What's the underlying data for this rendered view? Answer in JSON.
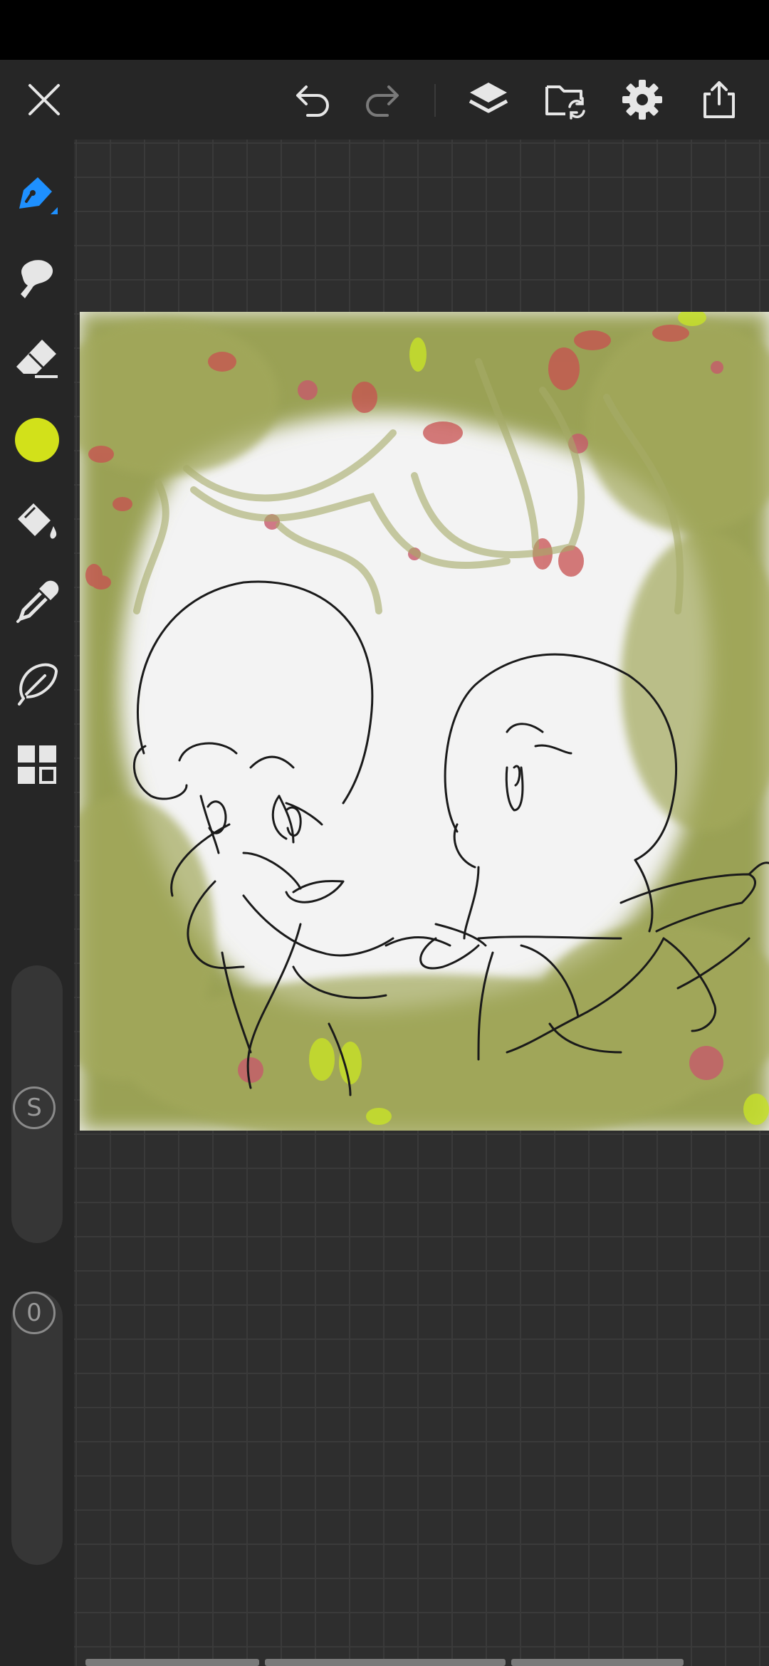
{
  "toolbar": {
    "close_icon": "close-icon",
    "undo_icon": "undo-icon",
    "redo_icon": "redo-icon",
    "layers_icon": "layers-icon",
    "gallery_icon": "folder-sync-icon",
    "settings_icon": "gear-icon",
    "share_icon": "share-icon"
  },
  "tools": [
    {
      "name": "pencil",
      "icon": "pencil-icon",
      "active": true
    },
    {
      "name": "smudge",
      "icon": "smudge-icon"
    },
    {
      "name": "eraser",
      "icon": "eraser-icon"
    },
    {
      "name": "color",
      "icon": "color-swatch",
      "value": "#d2e11a"
    },
    {
      "name": "fill",
      "icon": "paint-bucket-icon"
    },
    {
      "name": "eyedropper",
      "icon": "eyedropper-icon"
    },
    {
      "name": "lasso",
      "icon": "lasso-icon"
    },
    {
      "name": "more",
      "icon": "grid-icon"
    }
  ],
  "sliders": {
    "size": {
      "label": "S"
    },
    "opacity": {
      "label": "0"
    }
  },
  "colors": {
    "accent": "#1e90ff",
    "brush_color": "#d2e11a",
    "toolbar_bg": "#262626",
    "canvas_bg": "#2e2e2e"
  }
}
